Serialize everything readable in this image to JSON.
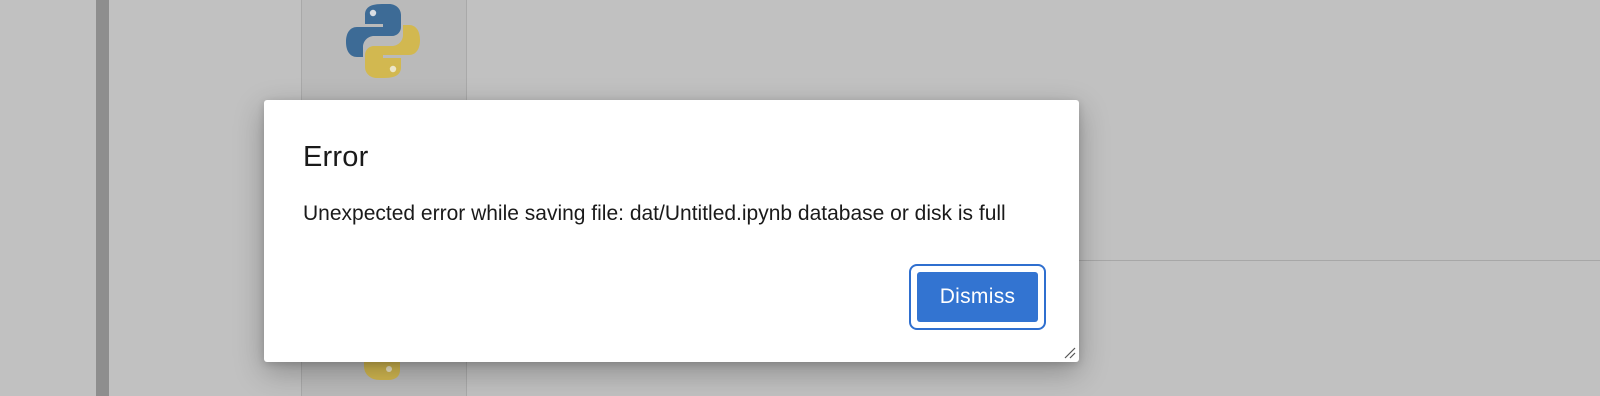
{
  "background": {
    "sidebar_color": "#8e8e8e",
    "backdrop_color": "#c1c1c1"
  },
  "launcher": {
    "kernel_icon": "python-logo-icon"
  },
  "dialog": {
    "title": "Error",
    "message": "Unexpected error while saving file: dat/Untitled.ipynb database or disk is full",
    "dismiss_label": "Dismiss",
    "accent_color": "#3374d1",
    "resize_icon": "resize-grip-icon"
  }
}
